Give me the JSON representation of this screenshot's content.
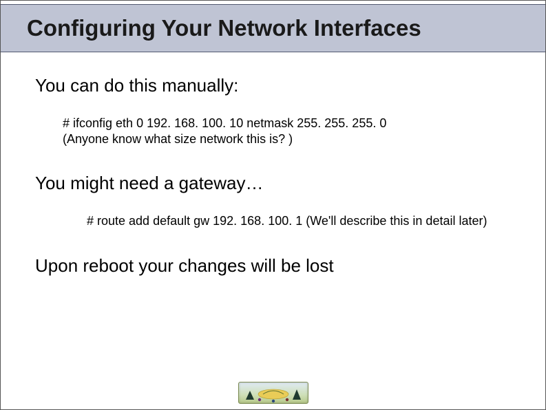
{
  "title": "Configuring Your Network Interfaces",
  "section1": {
    "heading": "You can do this manually:",
    "line1": "# ifconfig eth 0 192. 168. 100. 10 netmask 255. 255. 255. 0",
    "line2": "(Anyone know what size network this is? )"
  },
  "section2": {
    "heading": "You might need a gateway…",
    "line1": "# route add default gw 192. 168. 100. 1",
    "line2": "(We'll describe this in detail later)"
  },
  "section3": {
    "heading": "Upon reboot your changes will be lost"
  }
}
